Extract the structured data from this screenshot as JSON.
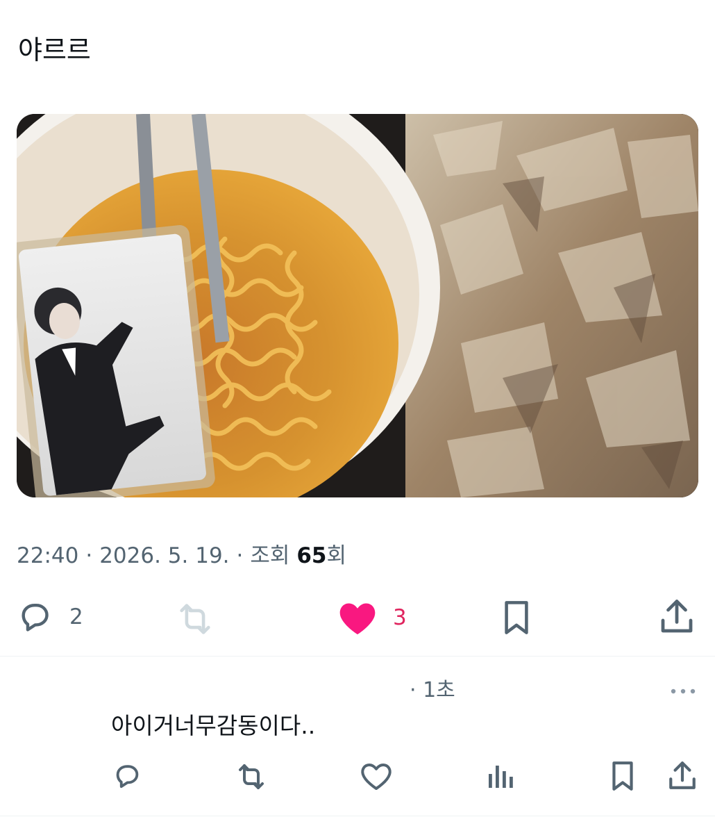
{
  "post": {
    "text": "야르르",
    "time": "22:40",
    "date": "2026. 5. 19.",
    "views_label": "조회",
    "views_count": "65",
    "views_suffix": "회"
  },
  "actions": {
    "replies": "2",
    "likes": "3"
  },
  "reply": {
    "time": "· 1초",
    "text": "아이거너무감동이다.."
  },
  "colors": {
    "like_active": "#f91880",
    "muted": "#536471",
    "divider": "#eff3f4"
  }
}
